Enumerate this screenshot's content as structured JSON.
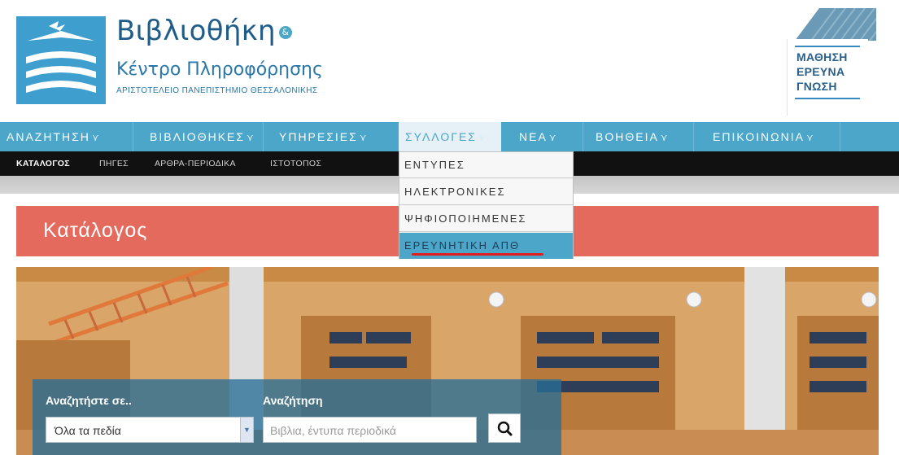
{
  "brand": {
    "title": "Βιβλιοθήκη",
    "badge": "&",
    "subtitle": "Κέντρο Πληροφόρησης",
    "university": "ΑΡΙΣΤΟΤΕΛΕΙΟ ΠΑΝΕΠΙΣΤΗΜΙΟ ΘΕΣΣΑΛΟΝΙΚΗΣ"
  },
  "tagline": [
    "ΜΑΘΗΣΗ",
    "ΕΡΕΥΝΑ",
    "ΓΝΩΣΗ"
  ],
  "nav": {
    "items": [
      {
        "label": "ΑΝΑΖΗΤΗΣΗ"
      },
      {
        "label": "ΒΙΒΛΙΟΘΗΚΕΣ"
      },
      {
        "label": "ΥΠΗΡΕΣΙΕΣ"
      },
      {
        "label": "ΣΥΛΛΟΓΕΣ"
      },
      {
        "label": "ΝΕΑ"
      },
      {
        "label": "ΒΟΗΘΕΙΑ"
      },
      {
        "label": "ΕΠΙΚΟΙΝΩΝΙΑ"
      }
    ],
    "chevron": "⋎"
  },
  "subnav": {
    "items": [
      {
        "label": "ΚΑΤΑΛΟΓΟΣ"
      },
      {
        "label": "ΠΗΓΕΣ"
      },
      {
        "label": "ΑΡΘΡΑ-ΠΕΡΙΟΔΙΚΑ"
      },
      {
        "label": "ΙΣΤΟΤΟΠΟΣ"
      }
    ]
  },
  "dropdown": {
    "items": [
      {
        "label": "ΕΝΤΥΠΕΣ"
      },
      {
        "label": "ΗΛΕΚΤΡΟΝΙΚΕΣ"
      },
      {
        "label": "ΨΗΦΙΟΠΟΙΗΜΕΝΕΣ"
      },
      {
        "label": "ΕΡΕΥΝΗΤΙΚΗ ΑΠΘ"
      }
    ]
  },
  "page": {
    "title": "Κατάλογος"
  },
  "search": {
    "scope_label": "Αναζητήστε σε..",
    "scope_value": "Όλα τα πεδία",
    "query_label": "Αναζήτηση",
    "query_placeholder": "Βιβλια, έντυπα περιοδικά"
  },
  "colors": {
    "nav": "#4ca6c9",
    "title_banner": "#e46a5e",
    "subnav": "#111111",
    "highlight_underline": "#e11d1d"
  }
}
